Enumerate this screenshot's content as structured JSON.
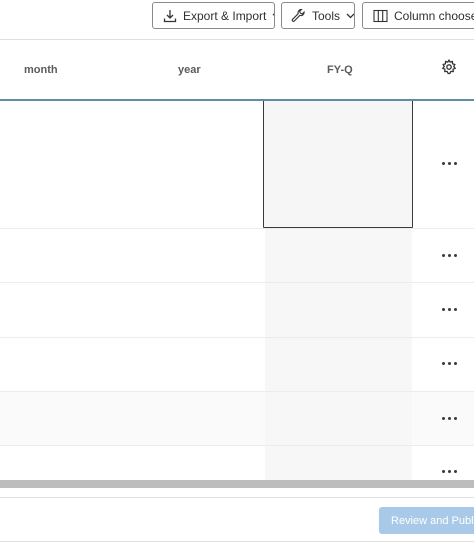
{
  "toolbar": {
    "export_label": "Export & Import",
    "tools_label": "Tools",
    "columns_label": "Column chooser"
  },
  "table": {
    "columns": [
      "month",
      "year",
      "FY-Q"
    ],
    "rows": [
      {
        "month": "",
        "year": "",
        "fyq": ""
      },
      {
        "month": "",
        "year": "",
        "fyq": ""
      },
      {
        "month": "",
        "year": "",
        "fyq": ""
      },
      {
        "month": "",
        "year": "",
        "fyq": ""
      },
      {
        "month": "",
        "year": "",
        "fyq": ""
      },
      {
        "month": "",
        "year": "",
        "fyq": ""
      }
    ]
  },
  "footer": {
    "publish_label": "Review and Publish"
  },
  "colors": {
    "header_underline": "#5a8fa6",
    "publish_button": "#a8c9e8"
  }
}
